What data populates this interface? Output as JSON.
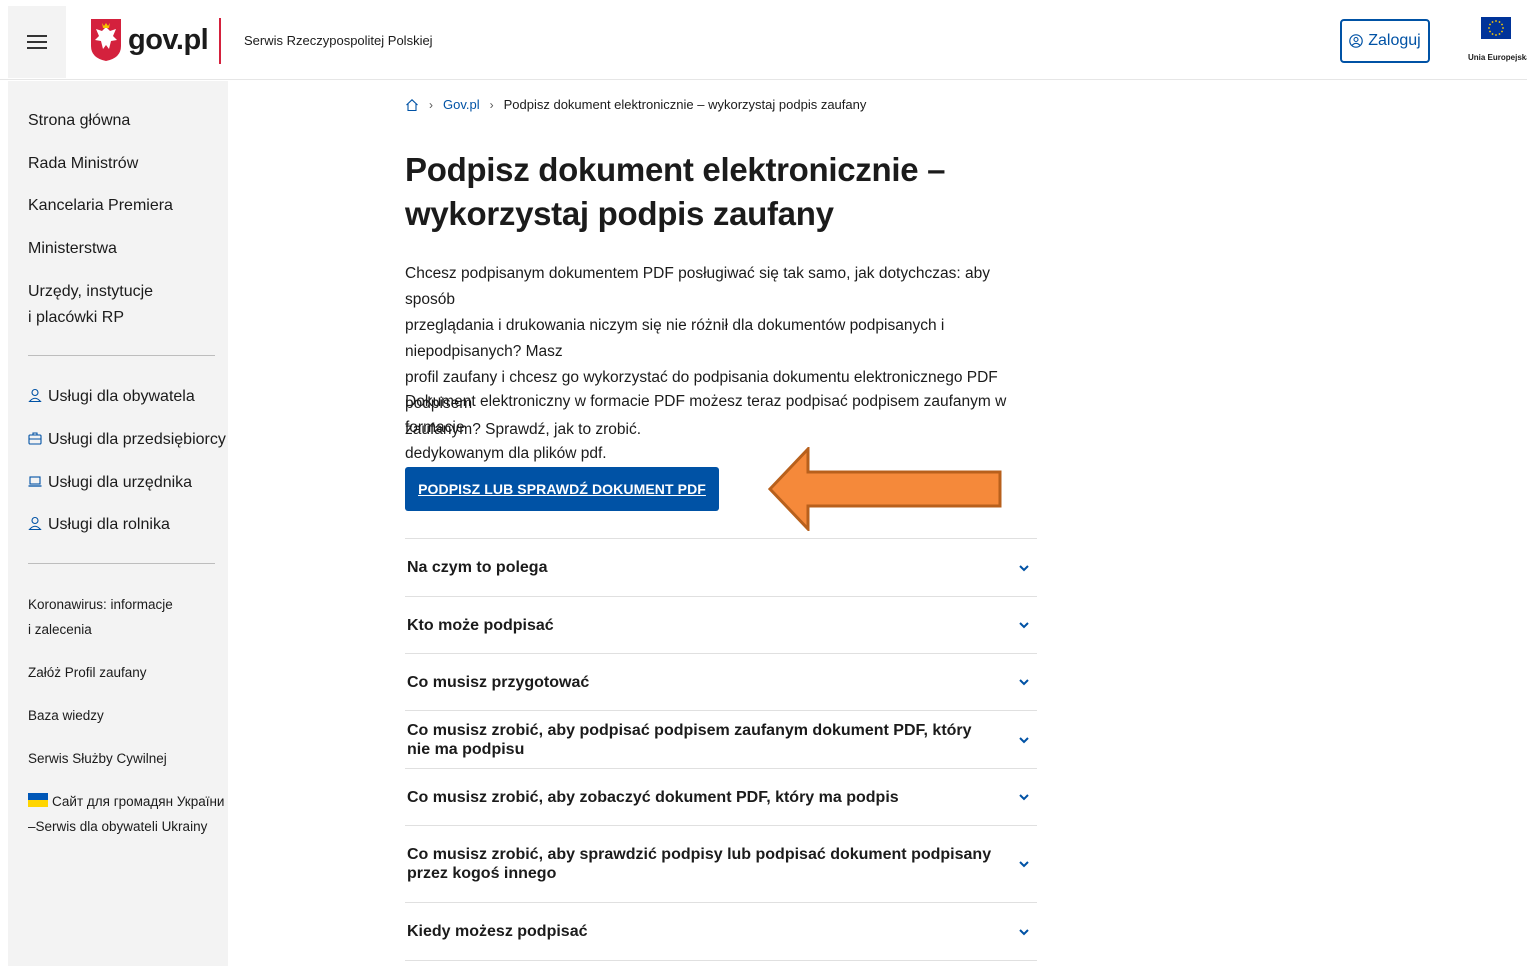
{
  "header": {
    "logo_text": "gov.pl",
    "service_name": "Serwis Rzeczypospolitej Polskiej",
    "login_label": "Zaloguj",
    "eu_label": "Unia Europejska"
  },
  "sidebar": {
    "main_links": [
      "Strona główna",
      "Rada Ministrów",
      "Kancelaria Premiera",
      "Ministerstwa",
      "Urzędy, instytucje",
      "i placówki RP"
    ],
    "services": [
      {
        "label": "Usługi dla obywatela",
        "icon": "person-icon"
      },
      {
        "label": "Usługi dla przedsiębiorcy",
        "icon": "briefcase-icon"
      },
      {
        "label": "Usługi dla urzędnika",
        "icon": "laptop-icon"
      },
      {
        "label": "Usługi dla rolnika",
        "icon": "person-icon"
      }
    ],
    "extra_links": [
      "Koronawirus: informacje",
      "i zalecenia",
      "Załóż Profil zaufany",
      "Baza wiedzy",
      "Serwis Służby Cywilnej",
      "Сайт для громадян України",
      "–Serwis dla obywateli Ukrainy"
    ]
  },
  "breadcrumb": {
    "home_icon": "home-icon",
    "items": [
      "Gov.pl",
      "Podpisz dokument elektronicznie – wykorzystaj podpis zaufany"
    ]
  },
  "main": {
    "title": "Podpisz dokument elektronicznie – wykorzystaj podpis zaufany",
    "intro_lines": [
      "Chcesz podpisanym dokumentem PDF posługiwać się tak samo, jak dotychczas: aby sposób",
      "przeglądania i drukowania niczym się nie różnił dla dokumentów podpisanych i niepodpisanych? Masz",
      "profil zaufany i chcesz go wykorzystać do podpisania dokumentu elektronicznego PDF podpisem",
      "zaufanym? Sprawdź, jak to zrobić."
    ],
    "second_lines": [
      "Dokument elektroniczny w formacie PDF możesz teraz podpisać podpisem zaufanym w formacie",
      "dedykowanym dla plików pdf."
    ],
    "cta_label": "PODPISZ LUB SPRAWDŹ DOKUMENT PDF",
    "accordion": [
      "Na czym to polega",
      "Kto może podpisać",
      "Co musisz przygotować",
      "Co musisz zrobić, aby podpisać podpisem zaufanym dokument PDF, który nie ma podpisu",
      "Co musisz zrobić, aby zobaczyć dokument PDF, który ma podpis",
      "Co musisz zrobić, aby sprawdzić podpisy lub podpisać dokument podpisany przez kogoś innego",
      "Kiedy możesz podpisać"
    ]
  },
  "colors": {
    "brand_blue": "#0052a5",
    "annotation_arrow": "#f5893a",
    "gov_red": "#d4213d"
  }
}
